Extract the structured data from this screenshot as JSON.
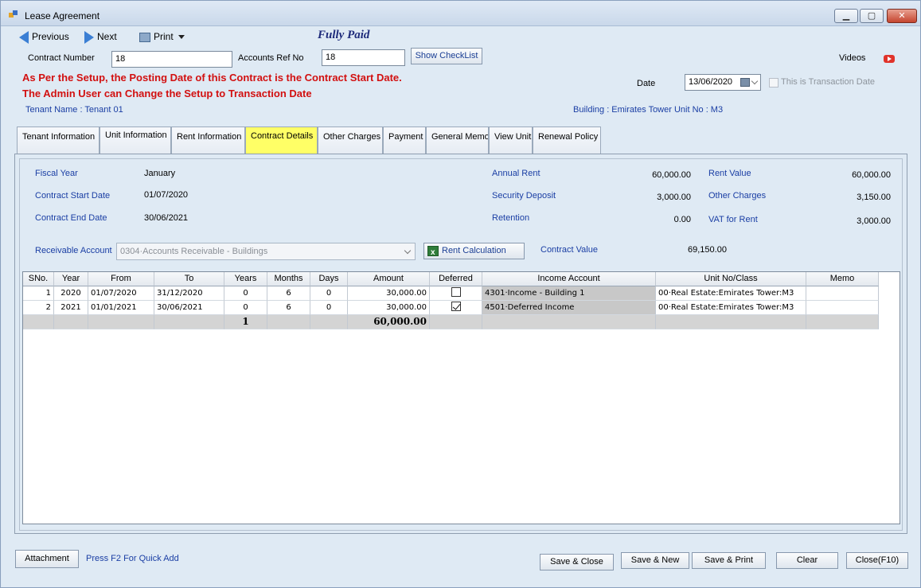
{
  "window": {
    "title": "Lease Agreement"
  },
  "toolbar": {
    "previous": "Previous",
    "next": "Next",
    "print": "Print"
  },
  "status": "Fully Paid",
  "fields": {
    "contract_number_label": "Contract Number",
    "contract_number": "18",
    "accounts_ref_label": "Accounts Ref No",
    "accounts_ref": "18",
    "show_checklist": "Show CheckList",
    "videos": "Videos",
    "date_label": "Date",
    "date": "13/06/2020",
    "transaction_date_label": "This is Transaction Date"
  },
  "notice": {
    "line1": "As Per the Setup, the Posting Date of this Contract is the Contract Start Date.",
    "line2": "The Admin User can Change the Setup to Transaction Date"
  },
  "tenant_name": "Tenant Name : Tenant 01",
  "building_info": "Building : Emirates Tower  Unit No : M3",
  "tabs": [
    "Tenant Information",
    "Unit Information",
    "Rent Information",
    "Contract Details",
    "Other Charges",
    "Payment",
    "General Memo",
    "View Unit",
    "Renewal Policy"
  ],
  "active_tab": "Contract Details",
  "details": {
    "fiscal_year_label": "Fiscal Year",
    "fiscal_year": "January",
    "start_label": "Contract Start Date",
    "start": "01/07/2020",
    "end_label": "Contract End Date",
    "end": "30/06/2021",
    "annual_rent_label": "Annual Rent",
    "annual_rent": "60,000.00",
    "security_label": "Security Deposit",
    "security": "3,000.00",
    "retention_label": "Retention",
    "retention": "0.00",
    "rent_value_label": "Rent Value",
    "rent_value": "60,000.00",
    "other_charges_label": "Other Charges",
    "other_charges": "3,150.00",
    "vat_label": "VAT for Rent",
    "vat": "3,000.00",
    "receivable_label": "Receivable Account",
    "receivable": "0304·Accounts Receivable - Buildings",
    "rent_calc": "Rent Calculation",
    "contract_value_label": "Contract Value",
    "contract_value": "69,150.00"
  },
  "grid": {
    "headers": [
      "SNo.",
      "Year",
      "From",
      "To",
      "Years",
      "Months",
      "Days",
      "Amount",
      "Deferred",
      "Income Account",
      "Unit No/Class",
      "Memo"
    ],
    "rows": [
      {
        "sno": "1",
        "year": "2020",
        "from": "01/07/2020",
        "to": "31/12/2020",
        "years": "0",
        "months": "6",
        "days": "0",
        "amount": "30,000.00",
        "deferred": false,
        "income": "4301·Income - Building 1",
        "unit": "00·Real Estate:Emirates Tower:M3",
        "memo": ""
      },
      {
        "sno": "2",
        "year": "2021",
        "from": "01/01/2021",
        "to": "30/06/2021",
        "years": "0",
        "months": "6",
        "days": "0",
        "amount": "30,000.00",
        "deferred": true,
        "income": "4501·Deferred Income",
        "unit": "00·Real Estate:Emirates Tower:M3",
        "memo": ""
      }
    ],
    "footer": {
      "years": "1",
      "amount": "60,000.00"
    }
  },
  "bottom": {
    "attachment": "Attachment",
    "hint": "Press F2 For Quick Add",
    "save_close": "Save & Close",
    "save_new": "Save & New",
    "save_print": "Save & Print",
    "clear": "Clear",
    "close": "Close(F10)"
  }
}
